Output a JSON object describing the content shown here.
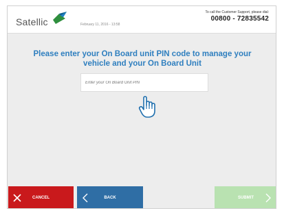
{
  "header": {
    "logo_text": "Satellic",
    "date_text": "February 11, 2016 - 13:58",
    "support_label": "To call the Customer Support, please dial:",
    "support_number": "00800 - 72835542"
  },
  "main": {
    "prompt_line_1": "Please enter your On Board unit PIN code to manage your",
    "prompt_line_2": "vehicle and your On Board Unit",
    "pin_placeholder": "Enter your On Board Unit PIN",
    "pin_value": ""
  },
  "buttons": {
    "cancel_label": "CANCEL",
    "back_label": "BACK",
    "submit_label": "SUBMIT"
  },
  "icons": {
    "logo": "satellic-logo-mark-icon",
    "cancel": "close-icon",
    "back": "chevron-left-icon",
    "submit": "chevron-right-icon",
    "pointer": "hand-pointer-icon"
  },
  "colors": {
    "brand_blue": "#2f7fbf",
    "cancel_red": "#c9191c",
    "back_blue": "#2f6ea5",
    "submit_green_disabled": "#b9e2b1",
    "content_bg": "#ededed"
  }
}
